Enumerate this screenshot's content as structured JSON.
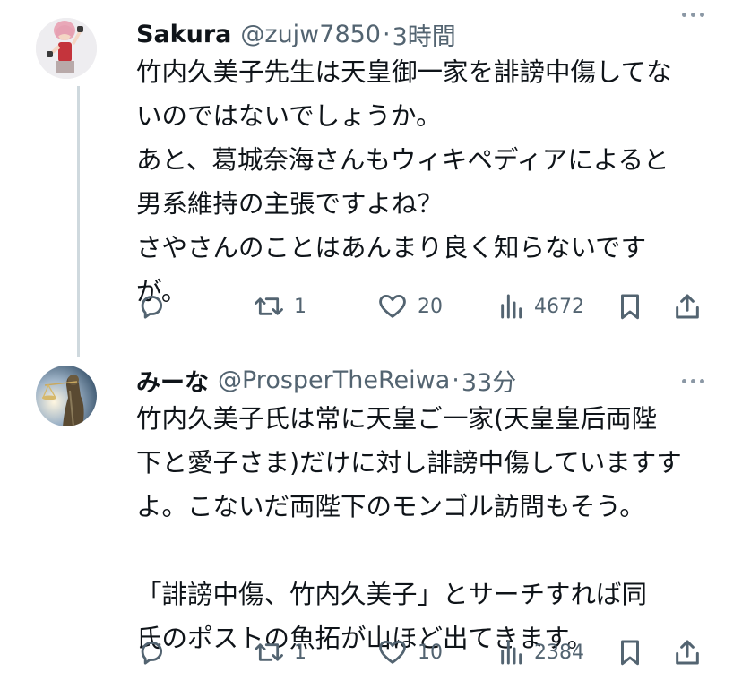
{
  "tweets": [
    {
      "name": "Sakura",
      "handle": "@zujw7850",
      "separator": "·",
      "time": "3時間",
      "body_lines": [
        "竹内久美子先生は天皇御一家を誹謗中傷してな",
        "いのではないでしょうか。",
        "あと、葛城奈海さんもウィキペディアによると",
        "男系維持の主張ですよね？",
        "さやさんのことはあんまり良く知らないです",
        "が。"
      ],
      "reply_count": "",
      "retweet_count": "1",
      "like_count": "20",
      "view_count": "4672",
      "avatar_icon": "sakura-avatar-icon"
    },
    {
      "name": "みーな",
      "handle": "@ProsperTheReiwa",
      "separator": "·",
      "time": "33分",
      "body_lines": [
        "竹内久美子氏は常に天皇ご一家(天皇皇后両陛",
        "下と愛子さま)だけに対し誹謗中傷していますす",
        "よ。こないだ両陛下のモンゴル訪問もそう。",
        "",
        "「誹謗中傷、竹内久美子」とサーチすれば同",
        "氏のポストの魚拓が山ほど出てきます。"
      ],
      "reply_count": "",
      "retweet_count": "1",
      "like_count": "10",
      "view_count": "2384",
      "avatar_icon": "lady-justice-avatar-icon"
    }
  ],
  "colors": {
    "text": "#0f1419",
    "secondary": "#536471",
    "thread_line": "#cfd9de"
  }
}
